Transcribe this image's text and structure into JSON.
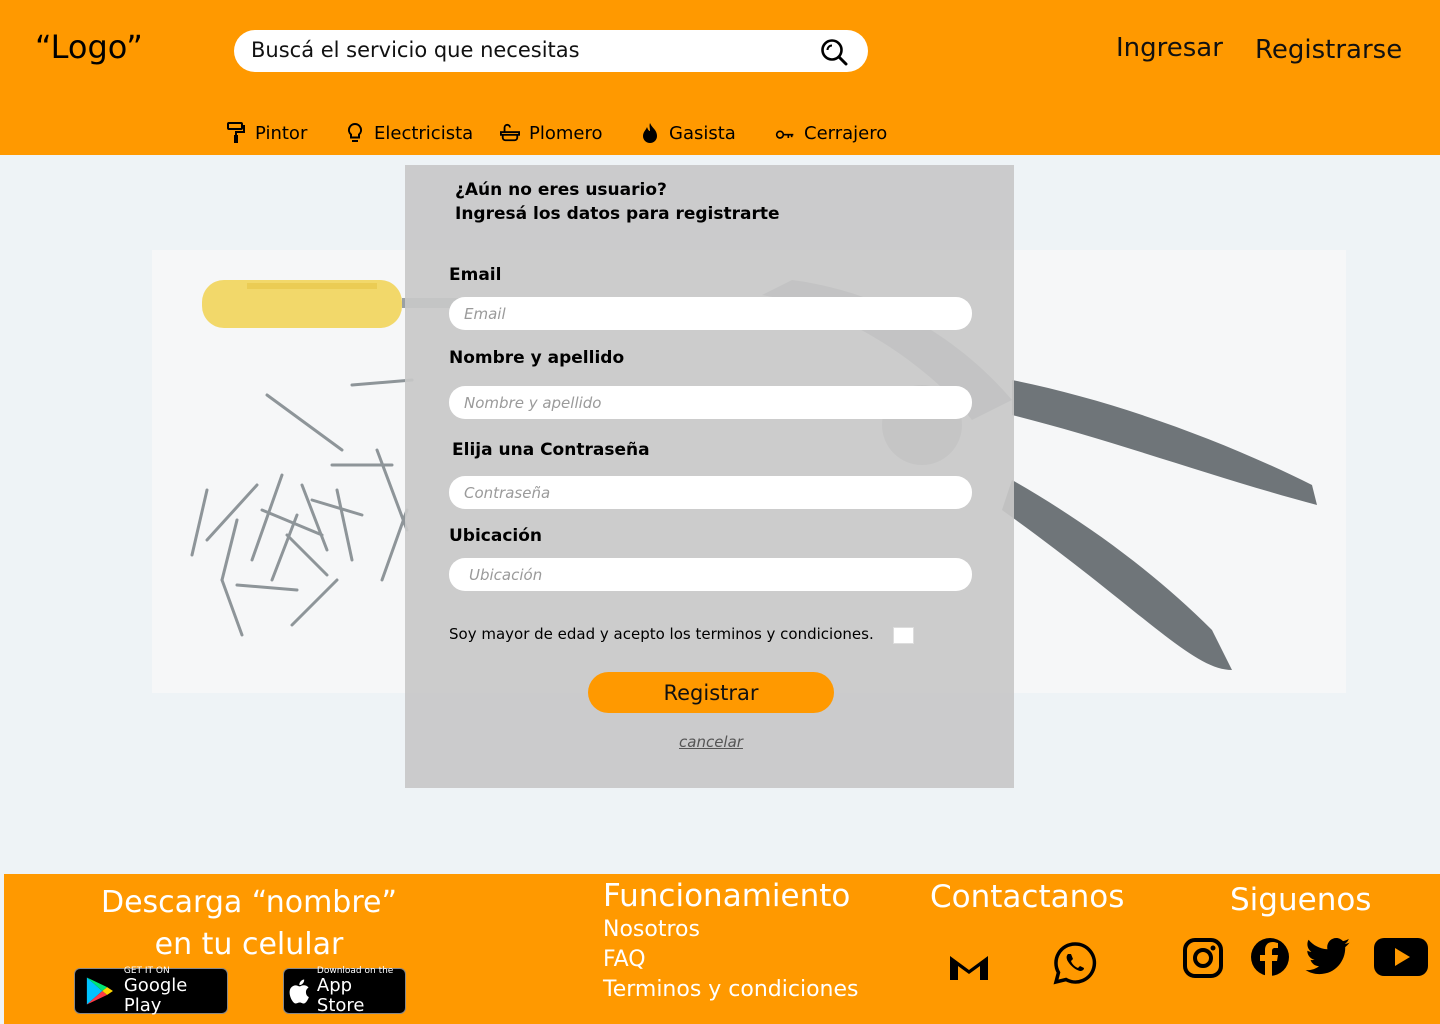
{
  "header": {
    "logo": "“Logo”",
    "search_placeholder": "Buscá el servicio que necesitas",
    "login": "Ingresar",
    "register": "Registrarse"
  },
  "categories": [
    {
      "label": "Pintor",
      "icon": "paint-roller-icon"
    },
    {
      "label": "Electricista",
      "icon": "lightbulb-icon"
    },
    {
      "label": "Plomero",
      "icon": "bathtub-icon"
    },
    {
      "label": "Gasista",
      "icon": "flame-icon"
    },
    {
      "label": "Cerrajero",
      "icon": "key-icon"
    }
  ],
  "form": {
    "title_line1": "¿Aún no eres usuario?",
    "title_line2": "Ingresá los datos para registrarte",
    "email_label": "Email",
    "email_placeholder": "Email",
    "name_label": "Nombre y apellido",
    "name_placeholder": "Nombre y apellido",
    "password_label": "Elija una Contraseña",
    "password_placeholder": "Contraseña",
    "location_label": "Ubicación",
    "location_placeholder": "Ubicación",
    "terms": "Soy mayor de edad y acepto los terminos y condiciones.",
    "submit": "Registrar",
    "cancel": "cancelar"
  },
  "footer": {
    "download_line1": "Descarga “nombre”",
    "download_line2": "en tu celular",
    "google_small": "GET IT ON",
    "google_big": "Google Play",
    "apple_small": "Download on the",
    "apple_big": "App Store",
    "funcionamiento": "Funcionamiento",
    "links": [
      "Nosotros",
      "FAQ",
      "Terminos y condiciones"
    ],
    "contact_title": "Contactanos",
    "follow_title": "Siguenos"
  },
  "colors": {
    "brand": "#ff9900",
    "background": "#eef3f6",
    "modal": "#c8c8c8"
  }
}
